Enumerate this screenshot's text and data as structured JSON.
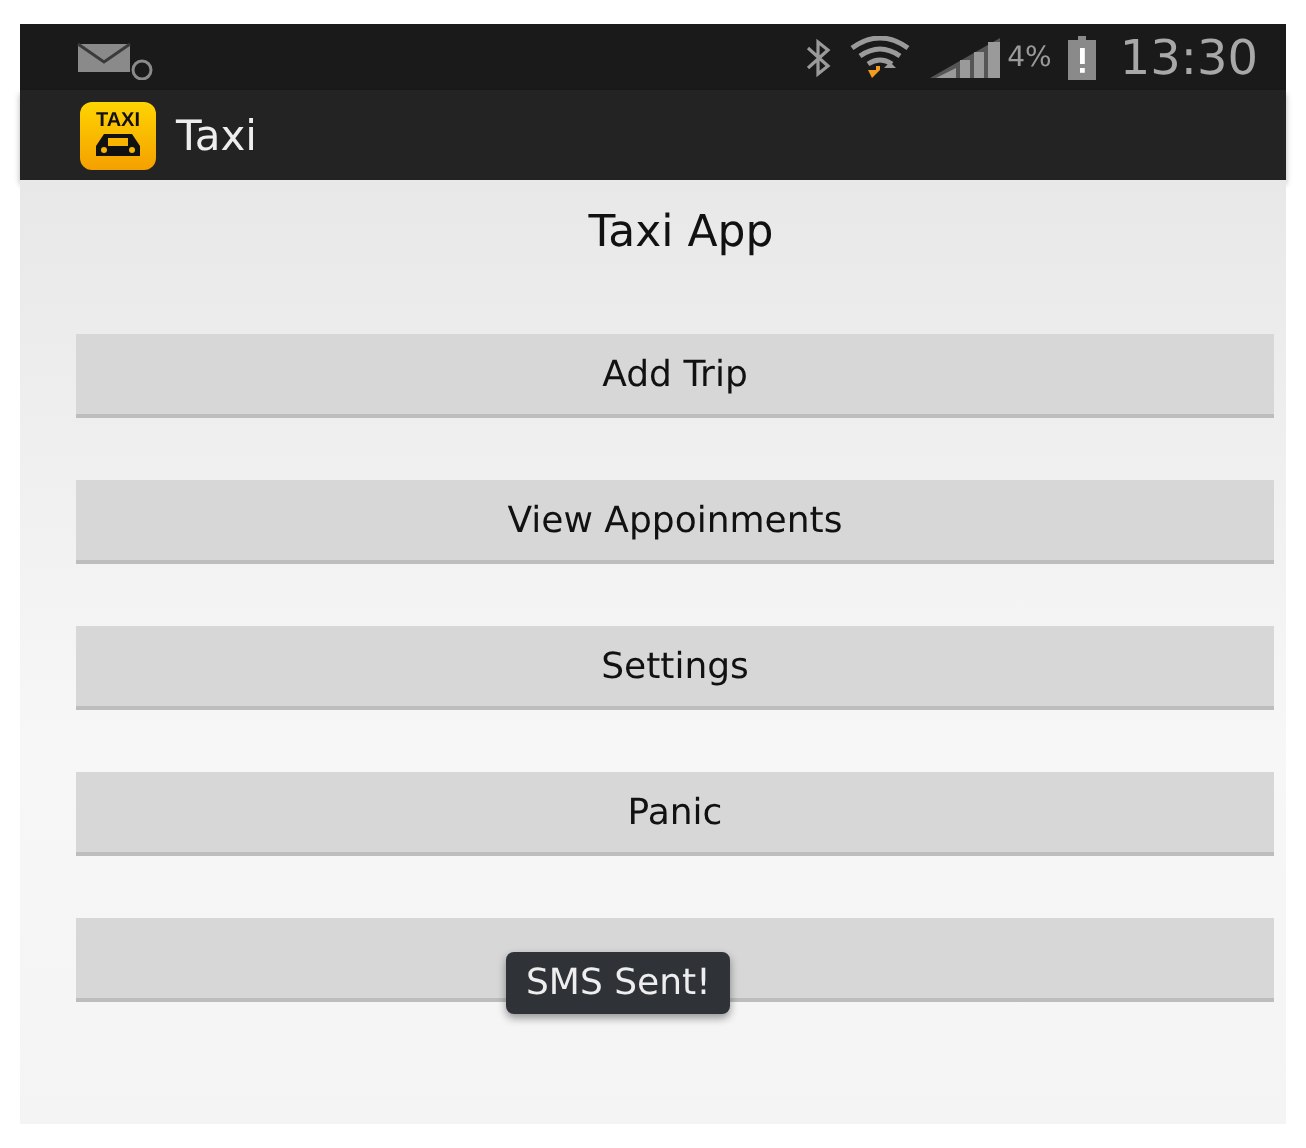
{
  "status_bar": {
    "battery_text": "4%",
    "time": "13:30"
  },
  "action_bar": {
    "logo_text": "TAXI",
    "title": "Taxi"
  },
  "heading": "Taxi App",
  "buttons": [
    {
      "kind": "button",
      "label": "Add Trip"
    },
    {
      "kind": "button",
      "label": "View Appoinments"
    },
    {
      "kind": "button",
      "label": "Settings"
    },
    {
      "kind": "button",
      "label": "Panic"
    },
    {
      "kind": "button"
    }
  ],
  "toast": "SMS Sent!"
}
